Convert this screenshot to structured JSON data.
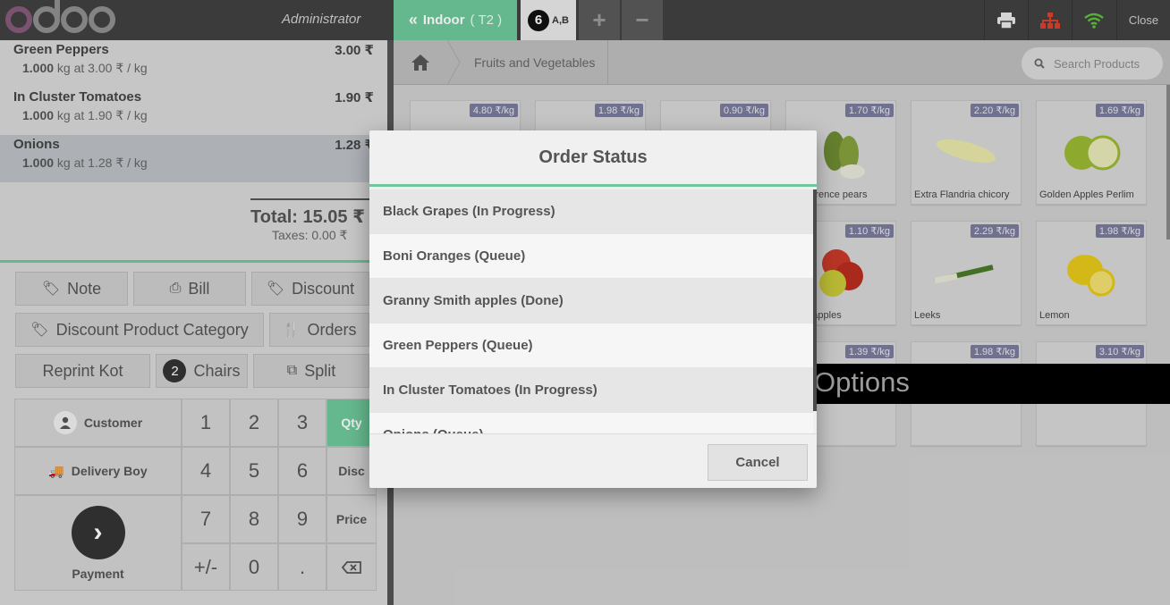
{
  "header": {
    "cashier": "Administrator",
    "floor_button": "Indoor",
    "floor_table": "( T2 )",
    "order_number": "6",
    "order_label": "A,B",
    "plus": "+",
    "minus": "−",
    "close": "Close",
    "colors": {
      "accent": "#6ec89b",
      "network": "#5cc03a",
      "proxy": "#d9402e"
    },
    "icons": [
      "printer-icon",
      "proxy-icon",
      "wifi-icon"
    ]
  },
  "order": {
    "lines": [
      {
        "name": "Green Peppers",
        "price": "3.00 ₹",
        "qty": "1.000",
        "unit_info": " kg at 3.00 ₹ / kg"
      },
      {
        "name": "In Cluster Tomatoes",
        "price": "1.90 ₹",
        "qty": "1.000",
        "unit_info": " kg at 1.90 ₹ / kg"
      },
      {
        "name": "Onions",
        "price": "1.28 ₹",
        "qty": "1.000",
        "unit_info": " kg at 1.28 ₹ / kg"
      }
    ],
    "total": "Total: 15.05 ₹",
    "taxes": "Taxes: 0.00 ₹"
  },
  "controls": {
    "note": "Note",
    "bill": "Bill",
    "discount": "Discount",
    "discount_category": "Discount Product Category",
    "orders": "Orders",
    "reprint": "Reprint Kot",
    "chairs_count": "2",
    "chairs": "Chairs",
    "split": "Split"
  },
  "numpad": {
    "customer": "Customer",
    "delivery_boy": "Delivery Boy",
    "payment": "Payment",
    "keys": [
      "1",
      "2",
      "3",
      "4",
      "5",
      "6",
      "7",
      "8",
      "9",
      "+/-",
      "0",
      "."
    ],
    "modes": {
      "qty": "Qty",
      "disc": "Disc",
      "price": "Price"
    }
  },
  "products": {
    "breadcrumb": "Fruits and Vegetables",
    "search_placeholder": "Search Products",
    "options_label": "Options",
    "items": [
      {
        "price": "4.80 ₹/kg",
        "name": ""
      },
      {
        "price": "1.98 ₹/kg",
        "name": ""
      },
      {
        "price": "0.90 ₹/kg",
        "name": ""
      },
      {
        "price": "1.70 ₹/kg",
        "name": "Conference pears"
      },
      {
        "price": "2.20 ₹/kg",
        "name": "Extra Flandria chicory"
      },
      {
        "price": "1.69 ₹/kg",
        "name": "Golden Apples Perlim"
      },
      {
        "price": "1.10 ₹/kg",
        "name": "Gold apples"
      },
      {
        "price": "2.29 ₹/kg",
        "name": "Leeks"
      },
      {
        "price": "1.98 ₹/kg",
        "name": "Lemon"
      },
      {
        "price": "1.39 ₹/kg",
        "name": ""
      },
      {
        "price": "1.98 ₹/kg",
        "name": ""
      },
      {
        "price": "3.10 ₹/kg",
        "name": ""
      }
    ]
  },
  "modal": {
    "title": "Order Status",
    "items": [
      "Black Grapes (In Progress)",
      "Boni Oranges (Queue)",
      "Granny Smith apples (Done)",
      "Green Peppers (Queue)",
      "In Cluster Tomatoes (In Progress)",
      "Onions (Queue)"
    ],
    "cancel": "Cancel"
  }
}
